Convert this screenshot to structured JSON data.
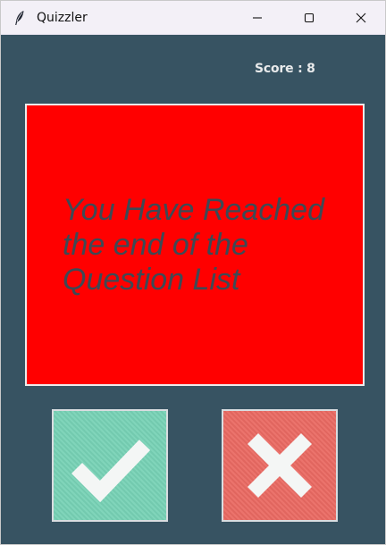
{
  "window": {
    "title": "Quizzler",
    "controls": {
      "minimize": "minimize",
      "maximize": "maximize",
      "close": "close"
    }
  },
  "header": {
    "score_text": "Score : 8"
  },
  "question": {
    "text": "You Have Reached the end of the Question List"
  },
  "answers": {
    "true_icon": "checkmark-icon",
    "false_icon": "cross-icon"
  },
  "colors": {
    "background": "#375362",
    "question_card": "#ff0000",
    "question_text": "#3d4a55",
    "true_button": "#78d2b6",
    "false_button": "#ea6a63"
  }
}
